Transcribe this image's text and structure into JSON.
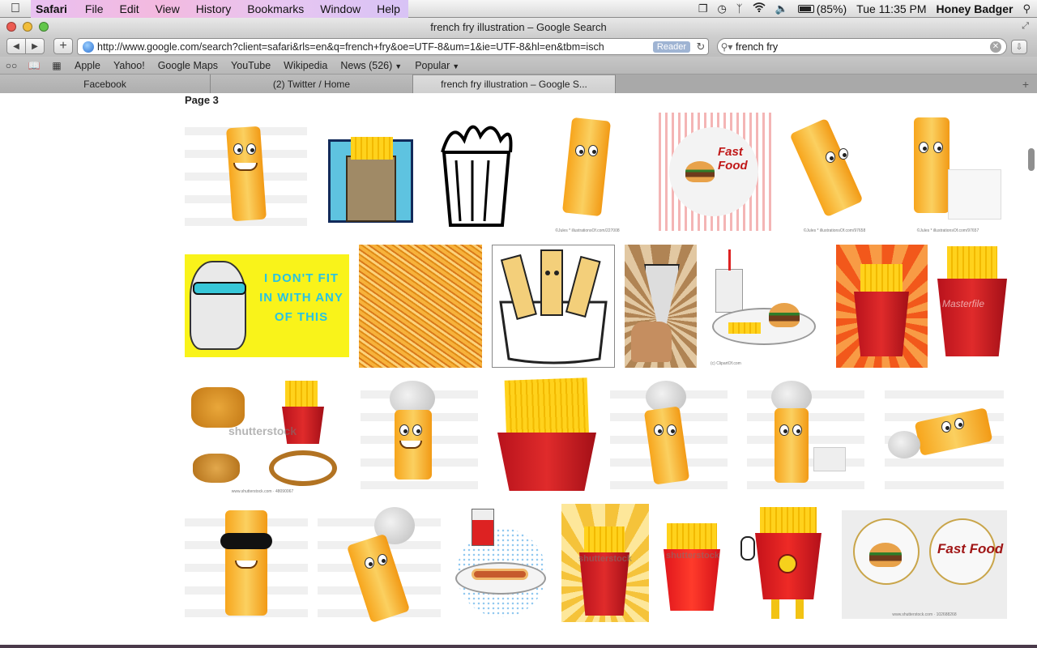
{
  "menubar": {
    "app_name": "Safari",
    "menus": [
      "File",
      "Edit",
      "View",
      "History",
      "Bookmarks",
      "Window",
      "Help"
    ],
    "battery": "(85%)",
    "battery_level": 0.85,
    "clock": "Tue 11:35 PM",
    "user": "Honey Badger",
    "icons": [
      "apple-icon",
      "dropbox-icon",
      "time-machine-icon",
      "bluetooth-icon",
      "wifi-icon",
      "volume-icon",
      "battery-icon",
      "spotlight-icon"
    ]
  },
  "window": {
    "title": "french fry illustration – Google Search"
  },
  "toolbar": {
    "url": "http://www.google.com/search?client=safari&rls=en&q=french+fry&oe=UTF-8&um=1&ie=UTF-8&hl=en&tbm=isch",
    "reader_label": "Reader",
    "search_value": "french fry"
  },
  "bookmarks": {
    "items": [
      {
        "label": "Apple"
      },
      {
        "label": "Yahoo!"
      },
      {
        "label": "Google Maps"
      },
      {
        "label": "YouTube"
      },
      {
        "label": "Wikipedia"
      },
      {
        "label": "News (526)",
        "dropdown": true
      },
      {
        "label": "Popular",
        "dropdown": true
      }
    ]
  },
  "tabs": [
    {
      "label": "Facebook",
      "active": false
    },
    {
      "label": "(2) Twitter / Home",
      "active": false
    },
    {
      "label": "french fry illustration – Google S...",
      "active": true
    }
  ],
  "content": {
    "page_label": "Page 3",
    "captions": {
      "jules_1": "©Jules * illustrationsOf.com/227008",
      "jules_2": "©Jules * illustrationsOf.com/97658",
      "jules_3": "©Jules * illustrationsOf.com/97657",
      "shutter_1": "www.shutterstock.com · 48090067",
      "shutter_2": "www.shutterstock.com · 102688268"
    },
    "meme_text": "I DON'T FIT IN WITH ANY OF THIS",
    "fastfood_text": "Fast Food",
    "watermarks": {
      "illustrations": "illustrations of.com",
      "shutterstock": "shutterstock",
      "masterfile": "Masterfile",
      "copyright": "(c) ClipartOf.com"
    }
  }
}
